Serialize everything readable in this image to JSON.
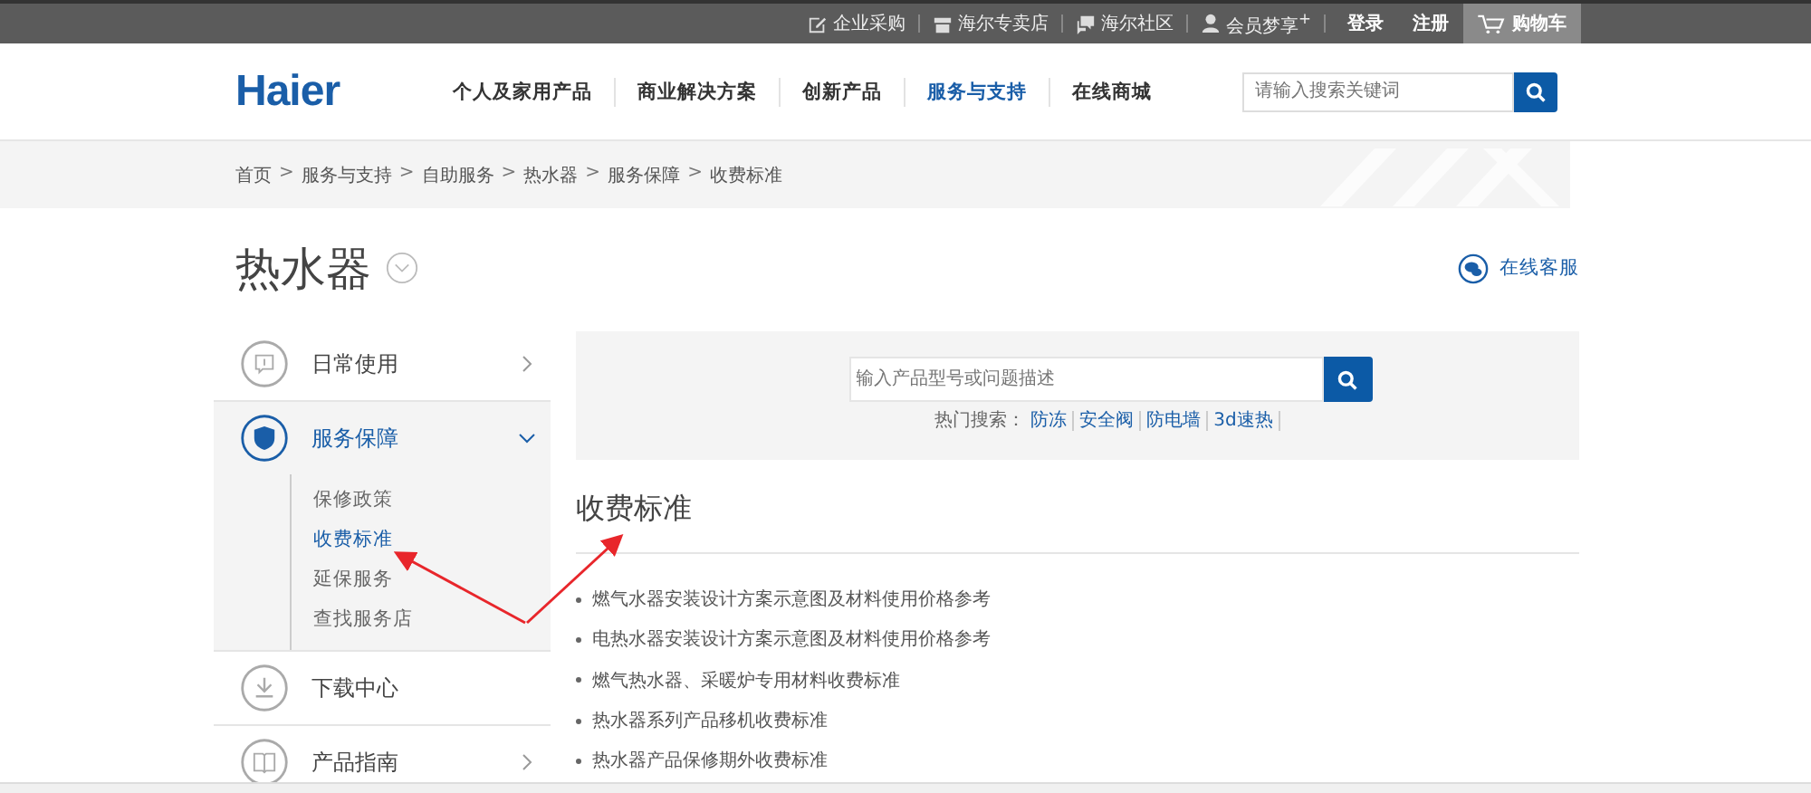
{
  "top_bar": {
    "links": [
      {
        "label": "企业采购"
      },
      {
        "label": "海尔专卖店"
      },
      {
        "label": "海尔社区"
      },
      {
        "label": "会员梦享$^{+}$"
      }
    ],
    "login": "登录",
    "register": "注册",
    "cart": "购物车"
  },
  "header": {
    "logo": "Haier",
    "nav": [
      {
        "label": "个人及家用产品",
        "selected": false
      },
      {
        "label": "商业解决方案",
        "selected": false
      },
      {
        "label": "创新产品",
        "selected": false
      },
      {
        "label": "服务与支持",
        "selected": true
      },
      {
        "label": "在线商城",
        "selected": false
      }
    ],
    "search": {
      "placeholder": "请输入搜索关键词"
    }
  },
  "breadcrumb": {
    "separator": ">",
    "items": [
      "首页",
      "服务与支持",
      "自助服务",
      "热水器",
      "服务保障",
      "收费标准"
    ]
  },
  "page_title": "热水器",
  "online_service": "在线客服",
  "sidebar": {
    "items": [
      {
        "label": "日常使用",
        "selected": false,
        "expanded": false
      },
      {
        "label": "服务保障",
        "selected": true,
        "expanded": true,
        "children": [
          {
            "label": "保修政策",
            "selected": false
          },
          {
            "label": "收费标准",
            "selected": true
          },
          {
            "label": "延保服务",
            "selected": false
          },
          {
            "label": "查找服务店",
            "selected": false
          }
        ]
      },
      {
        "label": "下载中心",
        "selected": false,
        "expanded": false
      },
      {
        "label": "产品指南",
        "selected": false,
        "expanded": false
      }
    ]
  },
  "search_panel": {
    "placeholder": "输入产品型号或问题描述",
    "hot_label": "热门搜索：",
    "hot_terms": [
      "防冻",
      "安全阀",
      "防电墙",
      "3d速热"
    ]
  },
  "section": {
    "title": "收费标准",
    "articles": [
      "燃气水器安装设计方案示意图及材料使用价格参考",
      "电热水器安装设计方案示意图及材料使用价格参考",
      "燃气热水器、采暖炉专用材料收费标准",
      "热水器系列产品移机收费标准",
      "热水器产品保修期外收费标准"
    ]
  }
}
